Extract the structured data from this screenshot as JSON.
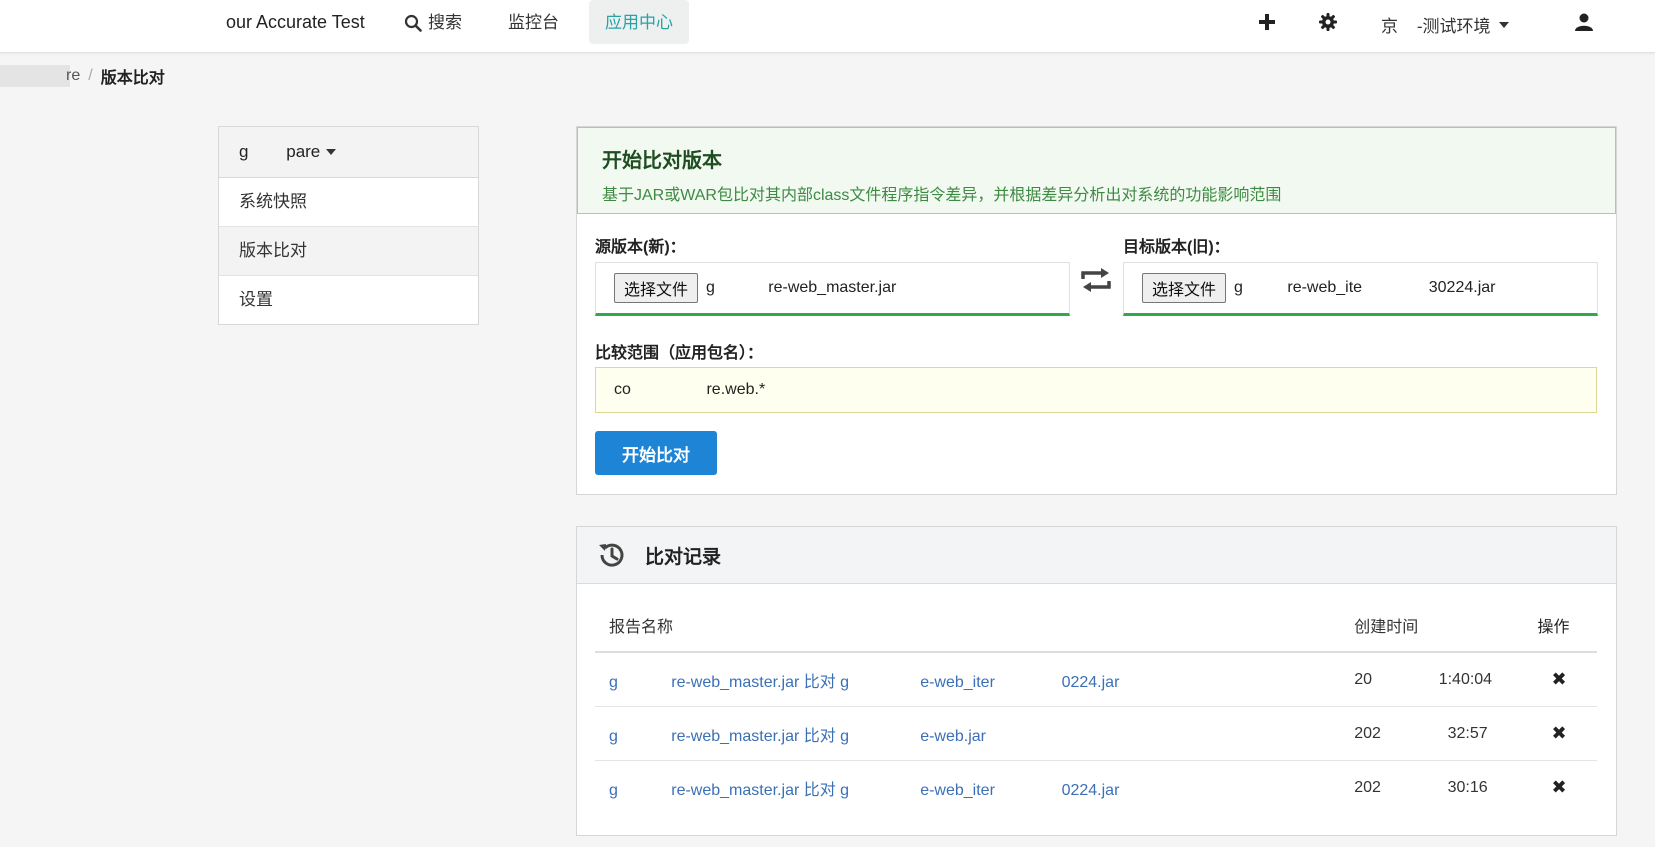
{
  "nav": {
    "brand": "our Accurate Test",
    "search": "搜索",
    "monitor": "监控台",
    "apps": "应用中心",
    "env": "京    -测试环境"
  },
  "breadcrumb": {
    "parent": "re",
    "current": "版本比对"
  },
  "sidebar": {
    "head": "g        pare",
    "items": [
      "系统快照",
      "版本比对",
      "设置"
    ]
  },
  "compare": {
    "title": "开始比对版本",
    "desc": "基于JAR或WAR包比对其内部class文件程序指令差异，并根据差异分析出对系统的功能影响范围",
    "source_label": "源版本(新)：",
    "target_label": "目标版本(旧)：",
    "choose_btn": "选择文件",
    "source_file": "g            re-web_master.jar",
    "target_file": "g          re-web_ite               30224.jar",
    "scope_label": "比较范围（应用包名）：",
    "scope_value": "co                 re.web.*",
    "start_btn": "开始比对"
  },
  "records": {
    "title": "比对记录",
    "col_name": "报告名称",
    "col_time": "创建时间",
    "col_op": "操作",
    "rows": [
      {
        "name": "g            re-web_master.jar 比对 g                e-web_iter               0224.jar",
        "time": "20               1:40:04"
      },
      {
        "name": "g            re-web_master.jar 比对 g                e-web.jar",
        "time": "202               32:57"
      },
      {
        "name": "g            re-web_master.jar 比对 g                e-web_iter               0224.jar",
        "time": "202               30:16"
      }
    ]
  },
  "colors": {
    "accent": "#28a2a5",
    "primary_btn": "#1d84d6",
    "link": "#3b6fb6",
    "success_line": "#2eaa4a"
  }
}
